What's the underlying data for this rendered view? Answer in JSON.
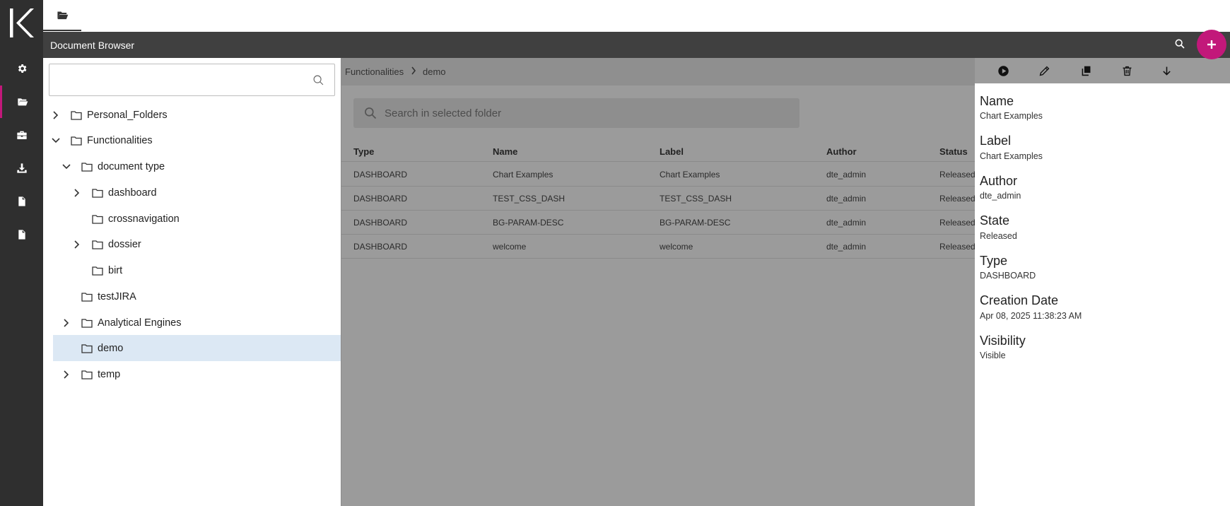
{
  "header": {
    "title": "Document Browser"
  },
  "rail": {
    "items": [
      {
        "icon": "gear-icon"
      },
      {
        "icon": "folder-open-icon"
      },
      {
        "icon": "briefcase-icon"
      },
      {
        "icon": "download-icon"
      },
      {
        "icon": "file-icon"
      },
      {
        "icon": "file-icon"
      }
    ],
    "accent_color": "#c2187a"
  },
  "tree": {
    "search_placeholder": "",
    "nodes": [
      {
        "label": "Personal_Folders",
        "expanded": false
      },
      {
        "label": "Functionalities",
        "expanded": true
      },
      {
        "label": "document type",
        "expanded": true
      },
      {
        "label": "dashboard",
        "expanded": false
      },
      {
        "label": "crossnavigation"
      },
      {
        "label": "dossier",
        "expanded": false
      },
      {
        "label": "birt"
      },
      {
        "label": "testJIRA"
      },
      {
        "label": "Analytical Engines",
        "expanded": false
      },
      {
        "label": "demo",
        "selected": true
      },
      {
        "label": "temp",
        "expanded": false
      }
    ]
  },
  "breadcrumb": [
    "Functionalities",
    "demo"
  ],
  "folder_search": {
    "placeholder": "Search in selected folder"
  },
  "table": {
    "headers": [
      "Type",
      "Name",
      "Label",
      "Author",
      "Status"
    ],
    "rows": [
      [
        "DASHBOARD",
        "Chart Examples",
        "Chart Examples",
        "dte_admin",
        "Released"
      ],
      [
        "DASHBOARD",
        "TEST_CSS_DASH",
        "TEST_CSS_DASH",
        "dte_admin",
        "Released"
      ],
      [
        "DASHBOARD",
        "BG-PARAM-DESC",
        "BG-PARAM-DESC",
        "dte_admin",
        "Released"
      ],
      [
        "DASHBOARD",
        "welcome",
        "welcome",
        "dte_admin",
        "Released"
      ]
    ]
  },
  "detail": {
    "toolbar": [
      "play-icon",
      "edit-icon",
      "copy-icon",
      "delete-icon",
      "arrow-down-icon"
    ],
    "fields": [
      {
        "label": "Name",
        "value": "Chart Examples"
      },
      {
        "label": "Label",
        "value": "Chart Examples"
      },
      {
        "label": "Author",
        "value": "dte_admin"
      },
      {
        "label": "State",
        "value": "Released"
      },
      {
        "label": "Type",
        "value": "DASHBOARD"
      },
      {
        "label": "Creation Date",
        "value": "Apr 08, 2025 11:38:23 AM"
      },
      {
        "label": "Visibility",
        "value": "Visible"
      }
    ]
  }
}
